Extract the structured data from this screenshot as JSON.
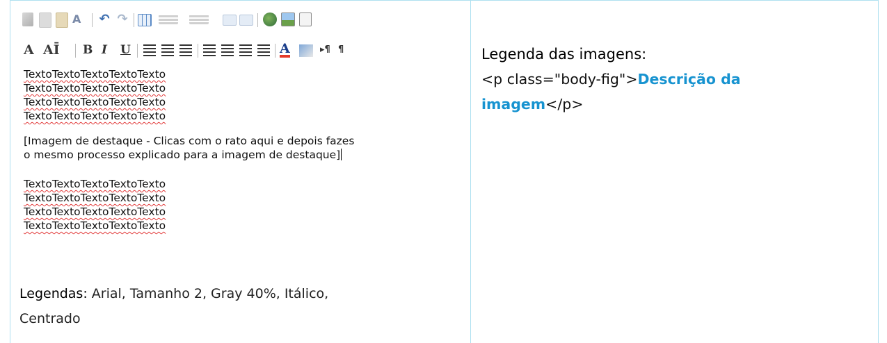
{
  "editor": {
    "toolbar_row2": {
      "font_color": "A",
      "font_size": "AĪ",
      "bold": "B",
      "italic": "I",
      "underline": "U"
    },
    "doc": {
      "text_block_1": [
        "TextoTextoTextoTextoTexto",
        "TextoTextoTextoTextoTexto",
        "TextoTextoTextoTextoTexto",
        "TextoTextoTextoTextoTexto"
      ],
      "placeholder_line1": "[Imagem de destaque - Clicas com o rato aqui e depois fazes",
      "placeholder_line2": "o mesmo processo explicado para a imagem de destaque]",
      "text_block_2": [
        "TextoTextoTextoTextoTexto",
        "TextoTextoTextoTextoTexto",
        "TextoTextoTextoTextoTexto",
        "TextoTextoTextoTextoTexto"
      ]
    }
  },
  "left_caption": {
    "label": "Legendas:",
    "text_line1": " Arial, Tamanho 2, Gray 40%, Itálico,",
    "text_line2": "Centrado"
  },
  "right": {
    "title": "Legenda das imagens:",
    "code_open": "<p class=\"body-fig\">",
    "code_highlight_1": "Descrição da",
    "code_highlight_2": "imagem",
    "code_close": "</p>"
  },
  "colors": {
    "grid": "#aee0f0",
    "highlight": "#1793d0",
    "spellcheck": "#e23a3a"
  }
}
